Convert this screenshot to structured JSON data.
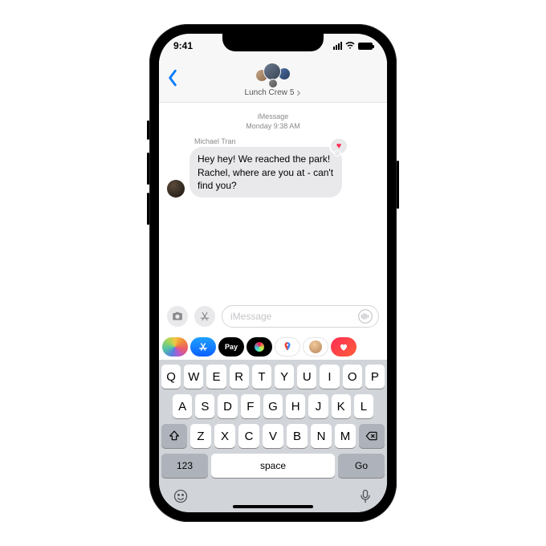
{
  "status": {
    "time": "9:41"
  },
  "header": {
    "group_name": "Lunch Crew",
    "member_count": "5"
  },
  "thread": {
    "service": "iMessage",
    "timestamp": "Monday 9:38 AM",
    "sender_name": "Michael Tran",
    "message_text": "Hey hey! We reached the park! Rachel, where are you at - can't find you?",
    "tapback_glyph": "♥"
  },
  "compose": {
    "placeholder": "iMessage"
  },
  "appstrip": {
    "pay_label": "Pay"
  },
  "keyboard": {
    "row1": [
      "Q",
      "W",
      "E",
      "R",
      "T",
      "Y",
      "U",
      "I",
      "O",
      "P"
    ],
    "row2": [
      "A",
      "S",
      "D",
      "F",
      "G",
      "H",
      "J",
      "K",
      "L"
    ],
    "row3": [
      "Z",
      "X",
      "C",
      "V",
      "B",
      "N",
      "M"
    ],
    "numbers_label": "123",
    "space_label": "space",
    "go_label": "Go"
  }
}
